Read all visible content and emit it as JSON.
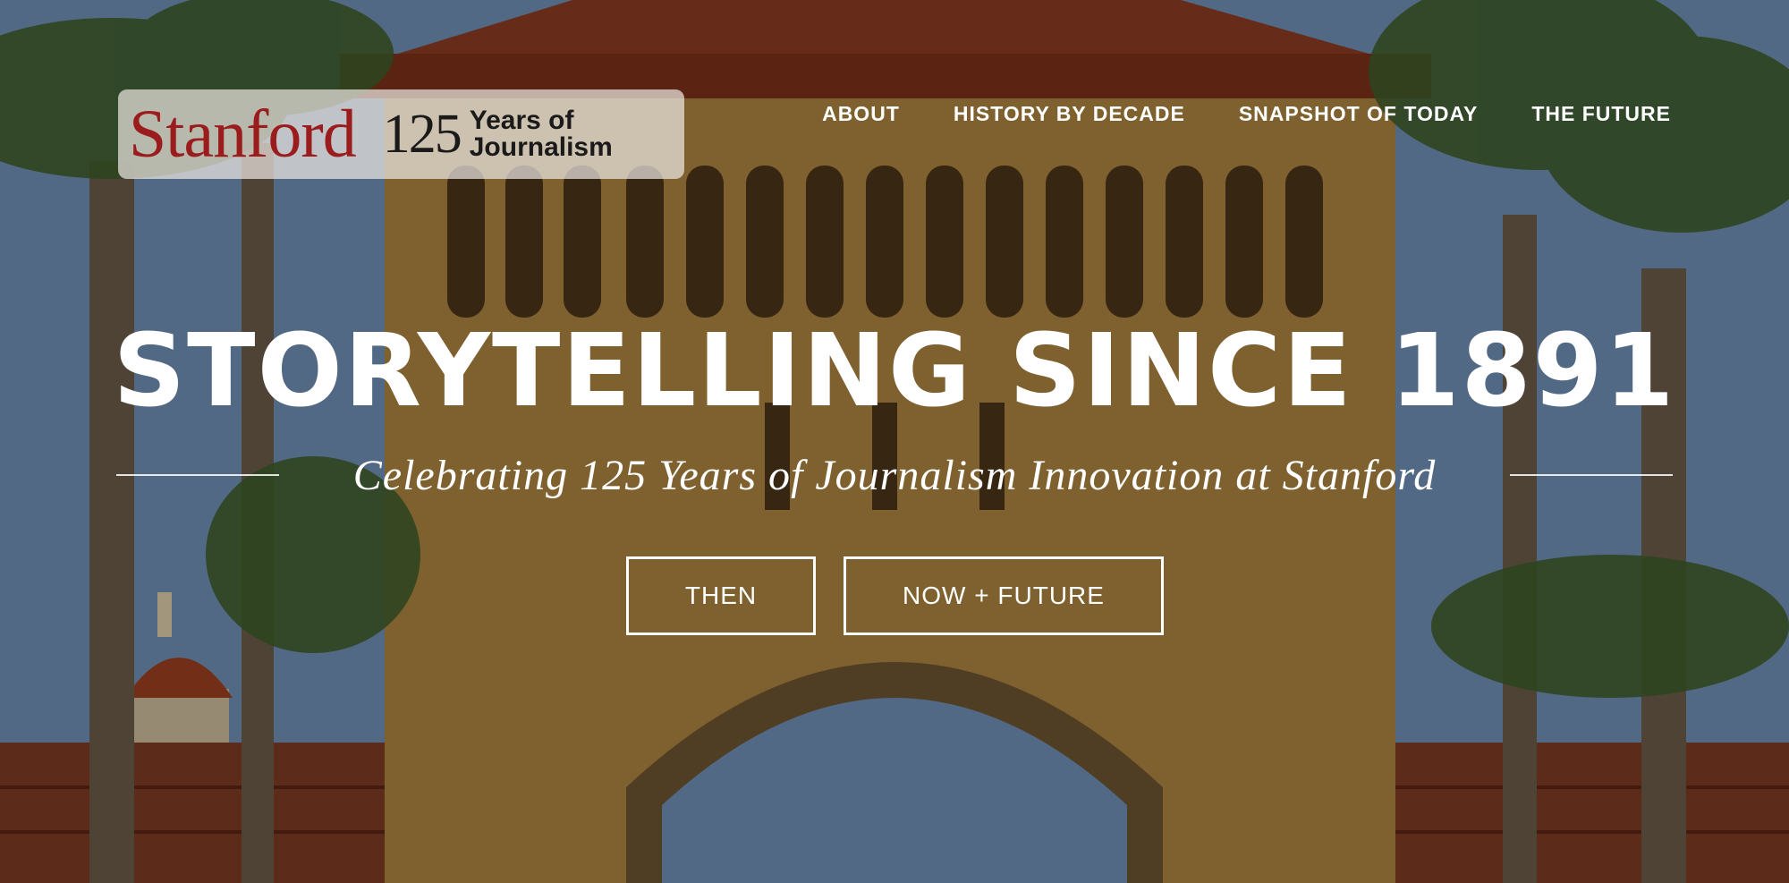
{
  "logo": {
    "brand": "Stanford",
    "years": "125",
    "line1": "Years of",
    "line2": "Journalism"
  },
  "nav": {
    "items": [
      "ABOUT",
      "HISTORY BY DECADE",
      "SNAPSHOT OF TODAY",
      "THE FUTURE"
    ]
  },
  "hero": {
    "title": "STORYTELLING SINCE 1891",
    "tagline": "Celebrating 125 Years of Journalism Innovation at Stanford",
    "buttons": {
      "then": "THEN",
      "now_future": "NOW + FUTURE"
    }
  },
  "colors": {
    "brand_red": "#9b1c1c",
    "sandstone": "#b08a4a",
    "roof_tile": "#8a3a22",
    "sky": "#6f8fb0"
  }
}
